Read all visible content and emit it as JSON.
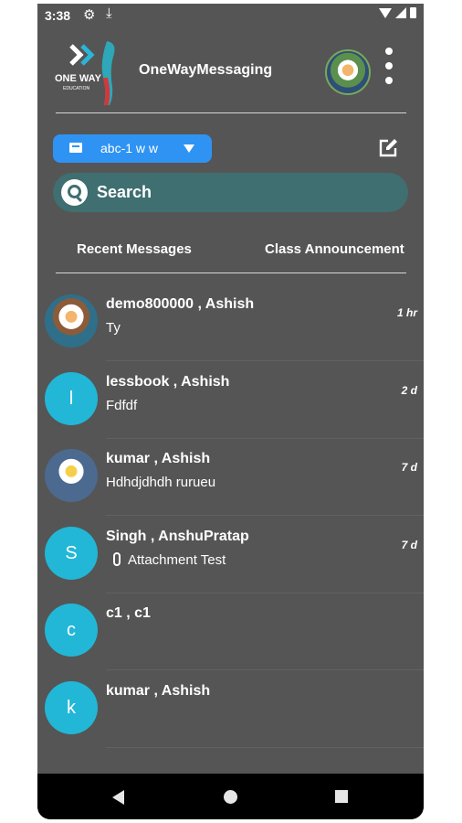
{
  "status_bar": {
    "time": "3:38"
  },
  "header": {
    "logo_text": "ONE WAY",
    "logo_subtext": "EDUCATION",
    "app_title": "OneWayMessaging"
  },
  "class_selector": {
    "selected": "abc-1 w w"
  },
  "search": {
    "label": "Search"
  },
  "tabs": [
    {
      "label": "Recent Messages"
    },
    {
      "label": "Class Announcement"
    }
  ],
  "conversations": [
    {
      "name": "demo800000 ,  Ashish",
      "preview": "Ty",
      "time": "1 hr",
      "avatar": ""
    },
    {
      "name": "lessbook ,  Ashish",
      "preview": "Fdfdf",
      "time": "2 d",
      "avatar": "l"
    },
    {
      "name": "kumar ,  Ashish",
      "preview": "Hdhdjdhdh rurueu",
      "time": "7 d",
      "avatar": ""
    },
    {
      "name": "Singh ,  AnshuPratap",
      "preview": "Attachment  Test",
      "time": "7 d",
      "avatar": "S"
    },
    {
      "name": "c1 ,  c1",
      "preview": "",
      "time": "",
      "avatar": "c"
    },
    {
      "name": "kumar ,  Ashish",
      "preview": "",
      "time": "",
      "avatar": "k"
    }
  ],
  "colors": {
    "background": "#555555",
    "select_blue": "#2f93f3",
    "search_teal": "#3f6f70",
    "avatar_cyan": "#22b7d6",
    "navbar": "#000000"
  }
}
